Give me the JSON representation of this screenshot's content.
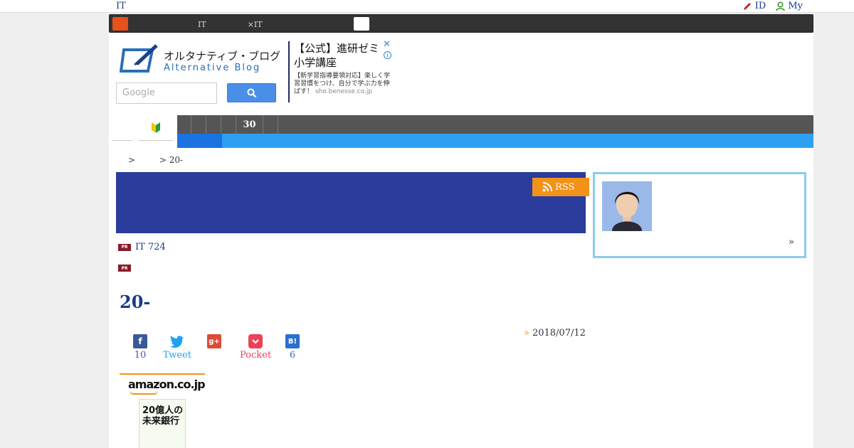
{
  "topbar": {
    "site_label": "IT",
    "id_label": "ID",
    "my_label": "My"
  },
  "catbar": {
    "items": [
      "",
      "",
      "",
      "IT",
      "×IT",
      "",
      ""
    ],
    "active_label": ""
  },
  "header": {
    "logo_jp": "オルタナティブ・ブログ",
    "logo_en": "Alternative Blog",
    "search_placeholder": "Google",
    "ad": {
      "headline_1": "【公式】進研ゼミ",
      "headline_2": "小学講座",
      "desc": "【新学習指導要領対応】楽しく学習習慣をつけ、自分で学ぶ力を伸ばす！",
      "url": "sho.benesse.co.jp"
    }
  },
  "nav": {
    "dark_segments": [
      "",
      "",
      "",
      "",
      "30",
      ""
    ]
  },
  "breadcrumb": {
    "sep1": ">",
    "current": "> 20-"
  },
  "banner": {
    "rss_label": "RSS"
  },
  "pr": {
    "badge": "PR",
    "line1": "IT 724",
    "line2": ""
  },
  "article": {
    "title": "20-",
    "date": "2018/07/12",
    "share": {
      "facebook_count": "10",
      "twitter_label": "Tweet",
      "pocket_label": "Pocket",
      "hatena_count": "6"
    }
  },
  "amazon": {
    "brand": "amazon.co.jp",
    "book_title": "20億人の未来銀行"
  },
  "sidebar": {
    "more_label": "»"
  },
  "colors": {
    "banner": "#2a3c9c",
    "rss": "#f39218",
    "nav_blue": "#2ea0f3",
    "facebook": "#3b5998",
    "twitter": "#1da1f2",
    "googleplus": "#dd4b39",
    "pocket": "#ef4056",
    "hatena": "#2a6fd0"
  }
}
